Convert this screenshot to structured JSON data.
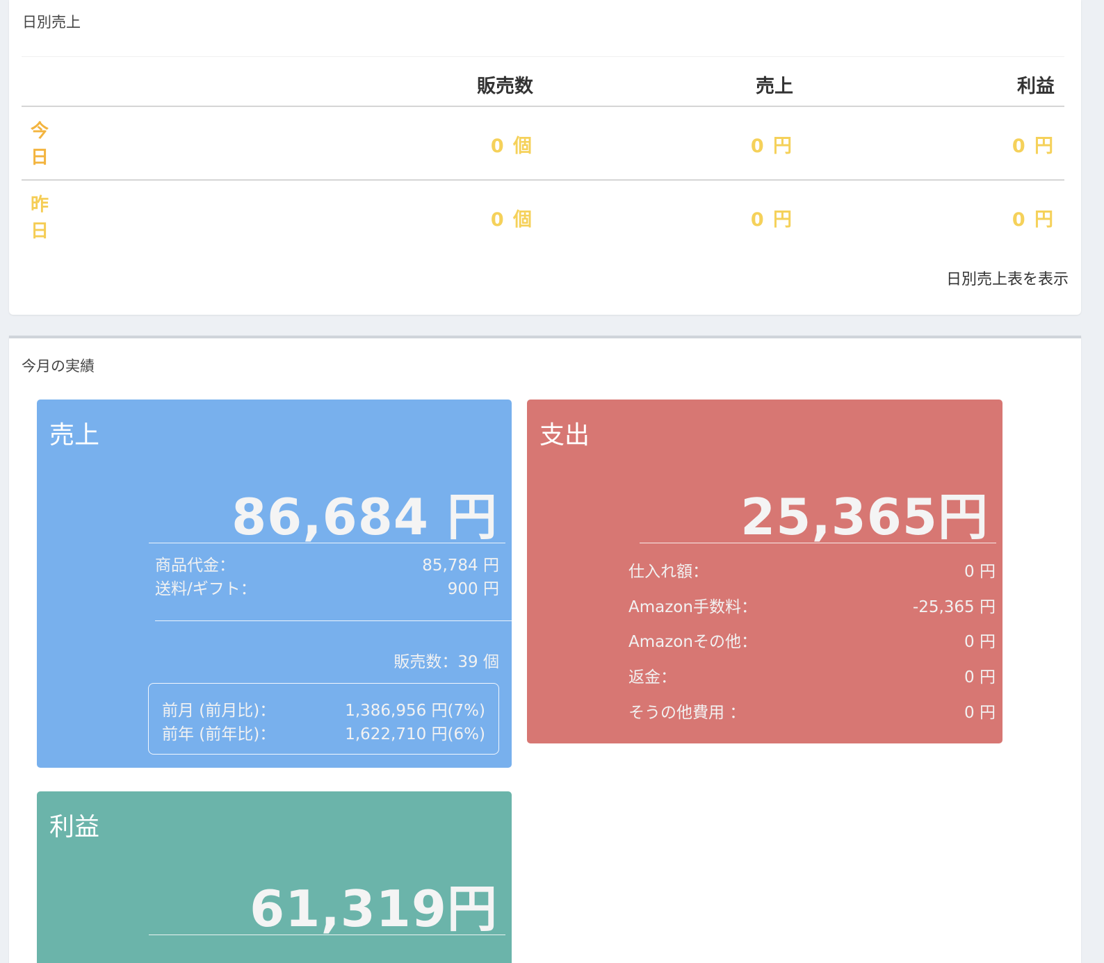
{
  "daily": {
    "title": "日別売上",
    "columns": [
      "販売数",
      "売上",
      "利益"
    ],
    "rows": [
      {
        "label": "今日",
        "count": "0 個",
        "sales": "0 円",
        "profit": "0 円"
      },
      {
        "label": "昨日",
        "count": "0 個",
        "sales": "0 円",
        "profit": "0 円"
      }
    ],
    "link": "日別売上表を表示"
  },
  "monthly": {
    "title": "今月の実績",
    "sales": {
      "title": "売上",
      "total": "86,684 円",
      "items": [
        {
          "label": "商品代金：",
          "value": "85,784 円"
        },
        {
          "label": "送料/ギフト：",
          "value": "900 円"
        }
      ],
      "count": "販売数：39 個",
      "compare": [
        {
          "label": "前月 (前月比)：",
          "value": "1,386,956 円(7%)"
        },
        {
          "label": "前年 (前年比)：",
          "value": "1,622,710 円(6%)"
        }
      ]
    },
    "expense": {
      "title": "支出",
      "total": "25,365円",
      "items": [
        {
          "label": "仕入れ額：",
          "value": "0 円"
        },
        {
          "label": "Amazon手数料：",
          "value": "-25,365 円"
        },
        {
          "label": "Amazonその他：",
          "value": "0 円"
        },
        {
          "label": "返金：",
          "value": "0 円"
        },
        {
          "label": "そうの他費用 ：",
          "value": "0 円"
        }
      ]
    },
    "profit": {
      "title": "利益",
      "total": "61,319円"
    }
  },
  "colors": {
    "sales_tile": "#78b0ed",
    "expense_tile": "#d77773",
    "profit_tile": "#6bb4aa",
    "today_label": "#f3b43f",
    "value_yellow": "#f5d15a"
  }
}
